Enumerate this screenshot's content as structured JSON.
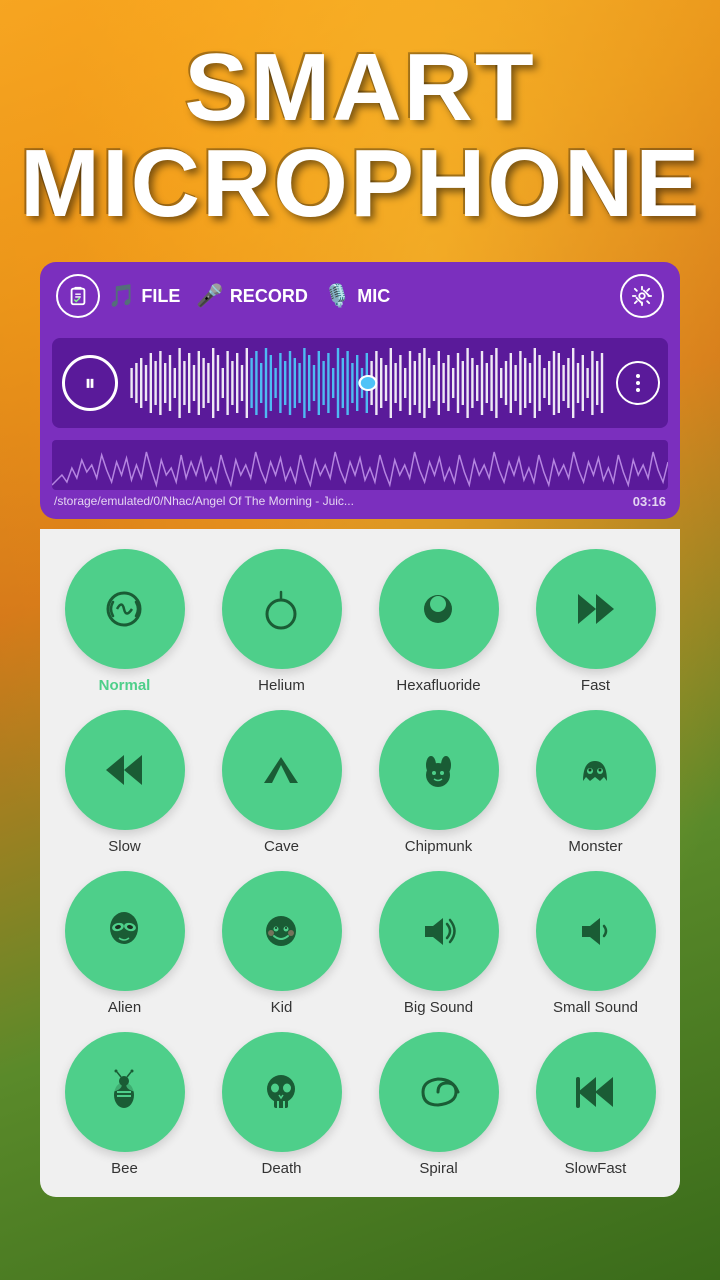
{
  "app": {
    "title_line1": "SMART",
    "title_line2": "MICROPHONE"
  },
  "player": {
    "tabs": [
      {
        "id": "file",
        "label": "FILE",
        "icon": "🎵"
      },
      {
        "id": "record",
        "label": "RECORD",
        "icon": "🎤"
      },
      {
        "id": "mic",
        "label": "MIC",
        "icon": "🎙️"
      }
    ],
    "file_path": "/storage/emulated/0/Nhac/Angel Of The Morning - Juic...",
    "duration": "03:16",
    "more_button_label": "⋮",
    "settings_icon": "⚙"
  },
  "effects": [
    {
      "id": "normal",
      "label": "Normal",
      "icon": "🔊",
      "active": true
    },
    {
      "id": "helium",
      "label": "Helium",
      "icon": "🎈",
      "active": false
    },
    {
      "id": "hexafluoride",
      "label": "Hexafluoride",
      "icon": "🎱",
      "active": false
    },
    {
      "id": "fast",
      "label": "Fast",
      "icon": "⏩",
      "active": false
    },
    {
      "id": "slow",
      "label": "Slow",
      "icon": "⏪",
      "active": false
    },
    {
      "id": "cave",
      "label": "Cave",
      "icon": "⛰",
      "active": false
    },
    {
      "id": "chipmunk",
      "label": "Chipmunk",
      "icon": "🐾",
      "active": false
    },
    {
      "id": "monster",
      "label": "Monster",
      "icon": "👻",
      "active": false
    },
    {
      "id": "alien",
      "label": "Alien",
      "icon": "👽",
      "active": false
    },
    {
      "id": "kid",
      "label": "Kid",
      "icon": "😊",
      "active": false
    },
    {
      "id": "big-sound",
      "label": "Big Sound",
      "icon": "🔊",
      "active": false
    },
    {
      "id": "small-sound",
      "label": "Small Sound",
      "icon": "🔉",
      "active": false
    },
    {
      "id": "bee",
      "label": "Bee",
      "icon": "🐝",
      "active": false
    },
    {
      "id": "death",
      "label": "Death",
      "icon": "💀",
      "active": false
    },
    {
      "id": "spiral",
      "label": "Spiral",
      "icon": "🌀",
      "active": false
    },
    {
      "id": "slowfast",
      "label": "SlowFast",
      "icon": "⏮",
      "active": false
    }
  ]
}
